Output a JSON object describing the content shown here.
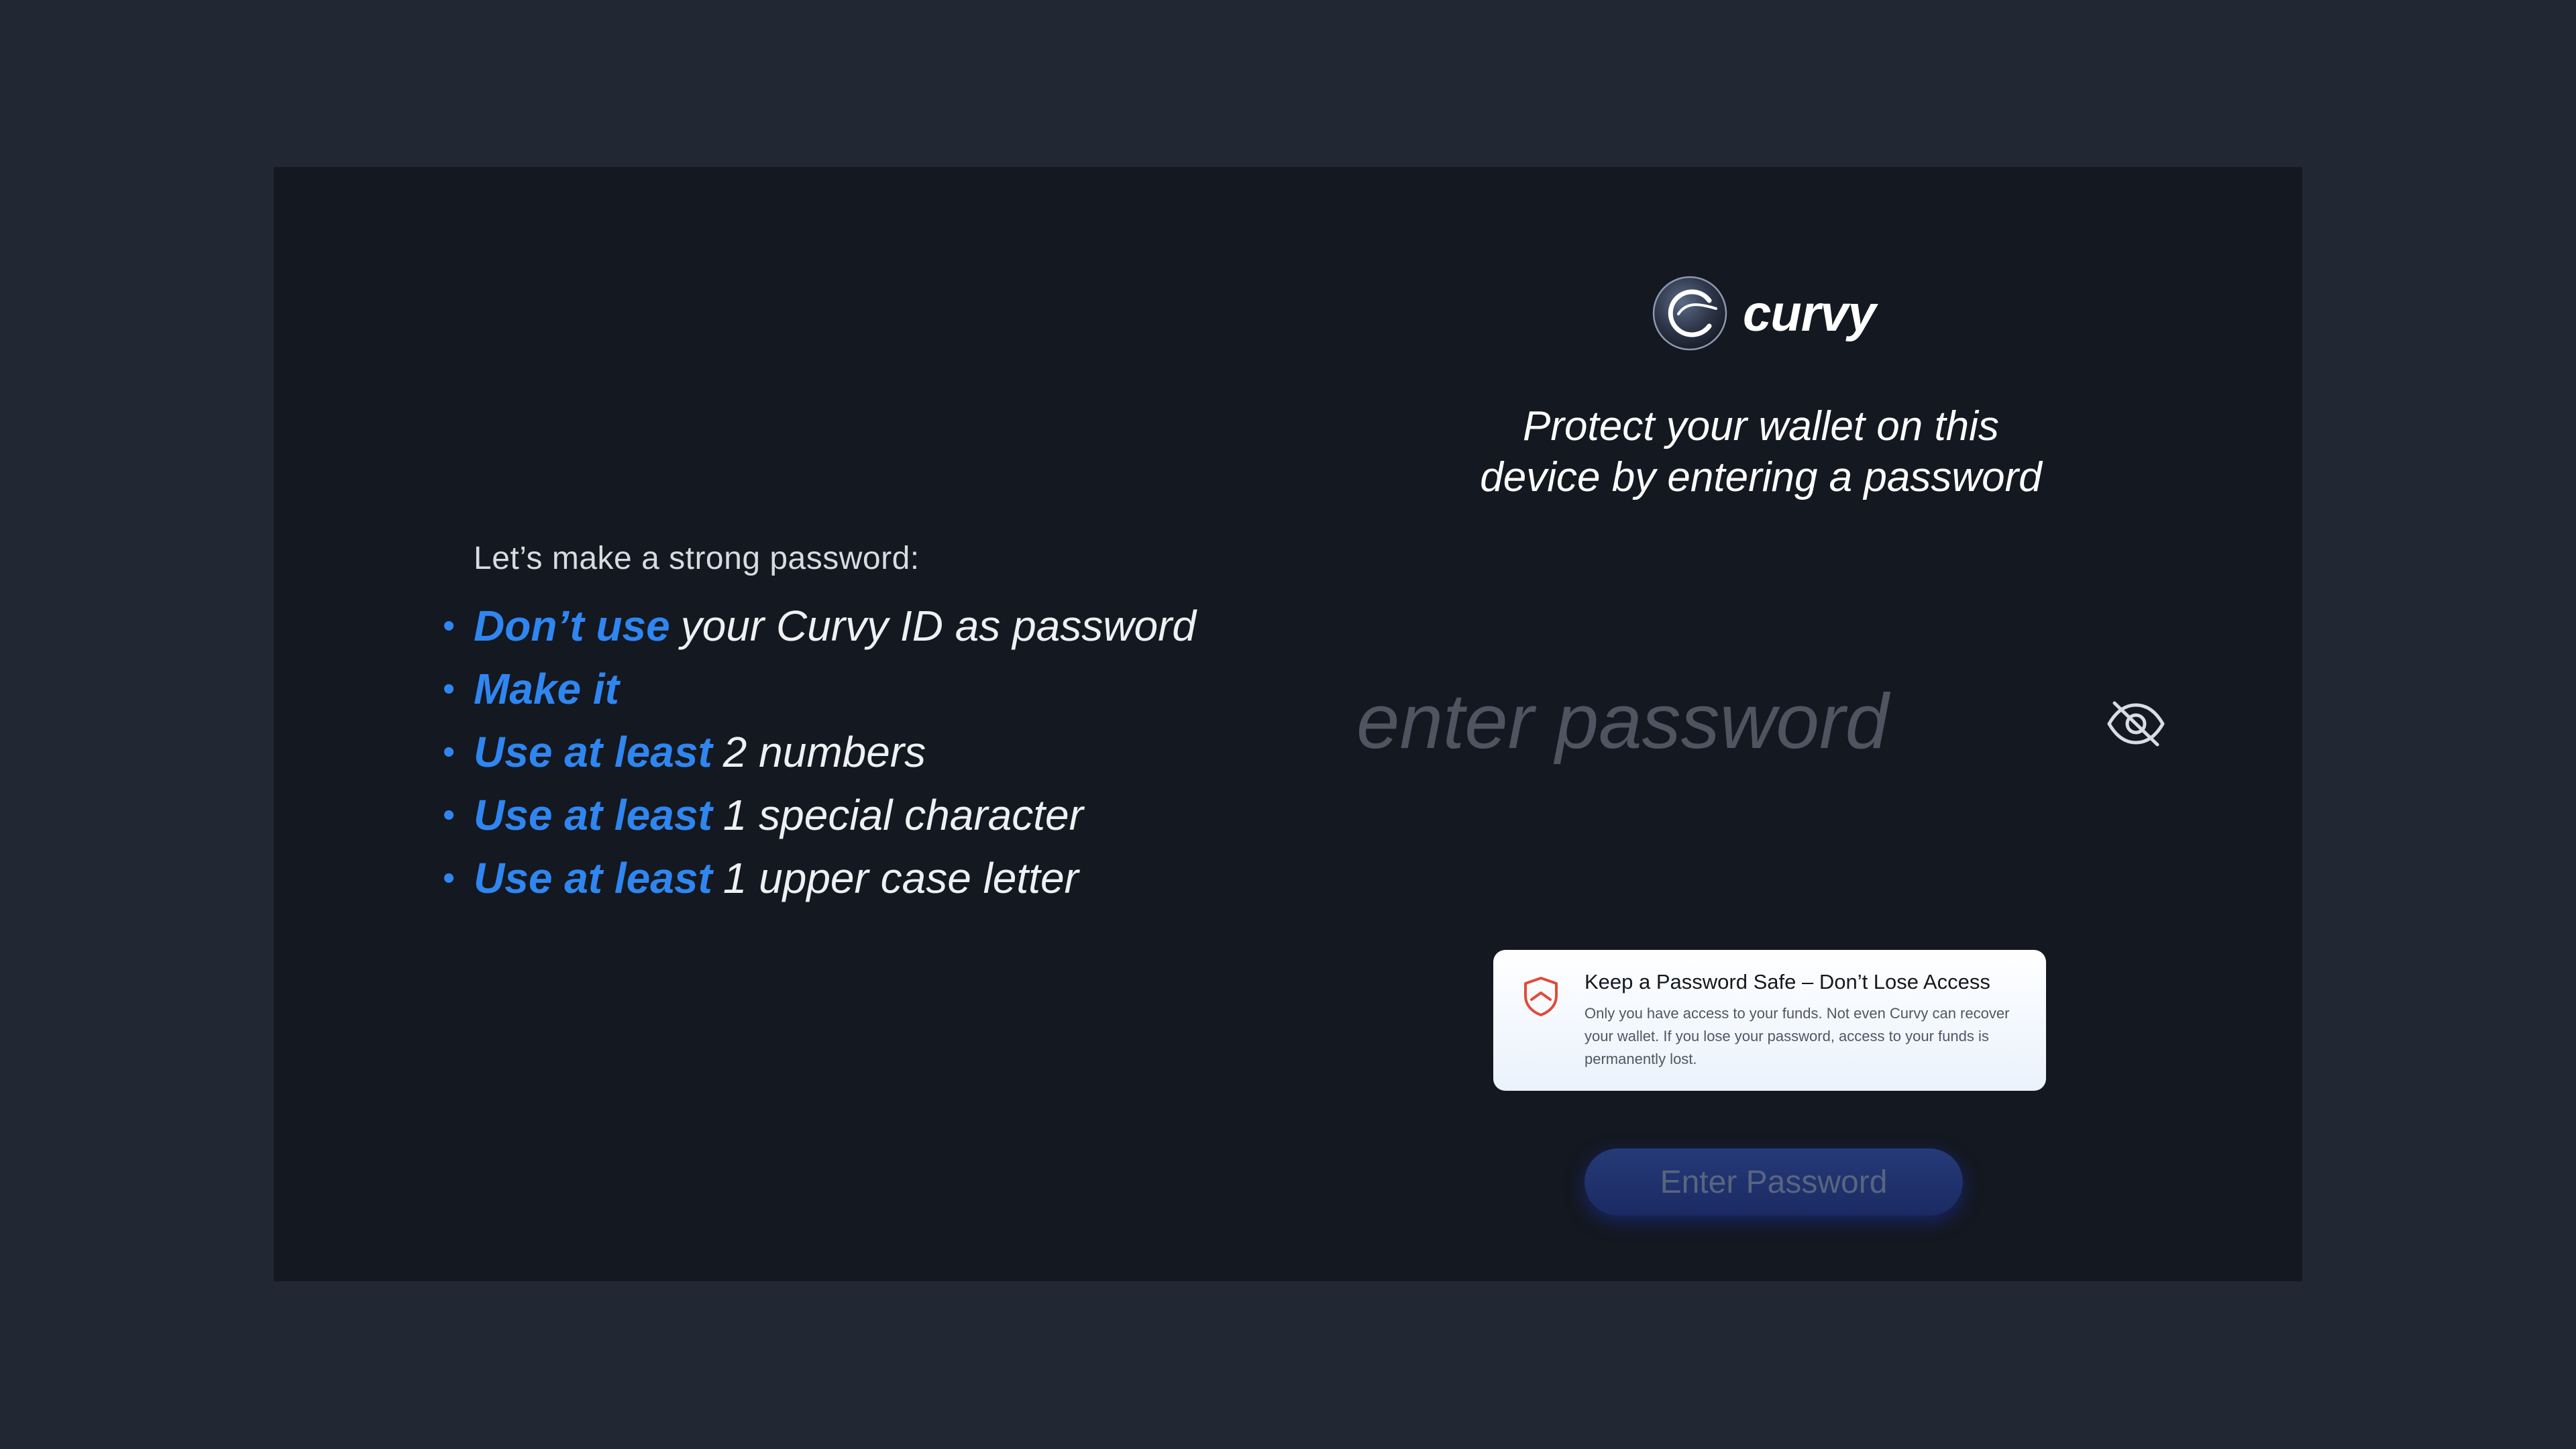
{
  "brand": {
    "name": "curvy",
    "logo_icon": "curvy-logo-icon"
  },
  "headline": {
    "line1": "Protect your wallet on this",
    "line2": "device by entering a password"
  },
  "tips": {
    "intro": "Let’s make a strong password:",
    "items": [
      {
        "strong": "Don’t use",
        "rest": "your Curvy ID as password"
      },
      {
        "strong": "Make it",
        "rest": ""
      },
      {
        "strong": "Use at least",
        "rest": "2 numbers"
      },
      {
        "strong": "Use at least",
        "rest": "1 special character"
      },
      {
        "strong": "Use at least",
        "rest": "1 upper case letter"
      }
    ]
  },
  "password_field": {
    "placeholder": "enter password",
    "value": "",
    "toggle_icon": "eye-off-icon"
  },
  "notice": {
    "icon": "shield-icon",
    "title": "Keep a Password Safe – Don’t Lose Access",
    "body": "Only you have access to your funds. Not even Curvy can recover your wallet. If you lose your password, access to your funds is permanently lost."
  },
  "submit": {
    "label": "Enter Password"
  },
  "colors": {
    "accent": "#2f86f0",
    "panel": "#141820",
    "background": "#222833",
    "notice_icon": "#e04a3a",
    "button": "#223470"
  }
}
